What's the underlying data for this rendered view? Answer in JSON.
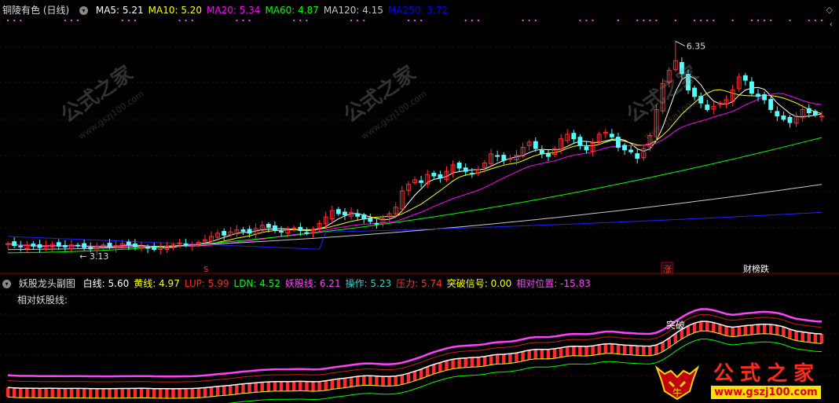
{
  "main_panel": {
    "stock_name": "铜陵有色 (日线)",
    "ma_labels": [
      {
        "text": "MA5: 5.21",
        "color": "#ffffff"
      },
      {
        "text": "MA10: 5.20",
        "color": "#ffff00"
      },
      {
        "text": "MA20: 5.34",
        "color": "#ff00ff"
      },
      {
        "text": "MA60: 4.87",
        "color": "#00ff00"
      },
      {
        "text": "MA120: 4.15",
        "color": "#c8c8c8"
      },
      {
        "text": "MA250: 3.72",
        "color": "#0000ff"
      }
    ],
    "high_annotation": "6.35",
    "low_annotation": "← 3.13",
    "event_labels": {
      "zhang": "涨",
      "caibang": "财榜跌",
      "marker": "S"
    }
  },
  "sub_panel": {
    "indicator_name": "妖股龙头副图",
    "sub_label": "相对妖股线:",
    "values": [
      {
        "text": "白线: 5.60",
        "color": "#ffffff"
      },
      {
        "text": "黄线: 4.97",
        "color": "#ffff00"
      },
      {
        "text": "LUP: 5.99",
        "color": "#ff2020"
      },
      {
        "text": "LDN: 4.52",
        "color": "#00ff00"
      },
      {
        "text": "妖股线: 6.21",
        "color": "#ff40ff"
      },
      {
        "text": "操作: 5.23",
        "color": "#40d0d0"
      },
      {
        "text": "压力: 5.74",
        "color": "#ff3030"
      },
      {
        "text": "突破信号: 0.00",
        "color": "#ffff00"
      },
      {
        "text": "相对位置: -15.83",
        "color": "#ff40ff"
      }
    ],
    "breakout_label": "突破"
  },
  "watermark": {
    "cn": "公式之家",
    "url": "www.gszj100.com"
  },
  "colors": {
    "up_candle": "#ff3030",
    "down_candle": "#54ffff",
    "background": "#000000"
  },
  "chart_data": {
    "type": "candlestick",
    "price_range": [
      3.0,
      6.5
    ],
    "close": [
      3.24,
      3.21,
      3.19,
      3.22,
      3.2,
      3.18,
      3.21,
      3.23,
      3.2,
      3.19,
      3.22,
      3.21,
      3.18,
      3.16,
      3.19,
      3.22,
      3.2,
      3.21,
      3.24,
      3.22,
      3.2,
      3.19,
      3.17,
      3.15,
      3.18,
      3.2,
      3.22,
      3.25,
      3.23,
      3.21,
      3.26,
      3.3,
      3.35,
      3.4,
      3.37,
      3.42,
      3.45,
      3.43,
      3.4,
      3.47,
      3.52,
      3.49,
      3.45,
      3.42,
      3.45,
      3.48,
      3.44,
      3.41,
      3.45,
      3.55,
      3.65,
      3.75,
      3.7,
      3.68,
      3.72,
      3.66,
      3.62,
      3.58,
      3.55,
      3.62,
      3.7,
      3.8,
      4.05,
      4.15,
      4.22,
      4.18,
      4.3,
      4.28,
      4.25,
      4.35,
      4.45,
      4.4,
      4.35,
      4.32,
      4.38,
      4.48,
      4.62,
      4.58,
      4.52,
      4.55,
      4.6,
      4.72,
      4.8,
      4.7,
      4.62,
      4.58,
      4.7,
      4.85,
      4.92,
      4.85,
      4.75,
      4.68,
      4.78,
      4.92,
      4.95,
      4.88,
      4.72,
      4.68,
      4.65,
      4.55,
      4.7,
      4.9,
      5.3,
      5.7,
      5.9,
      6.05,
      5.85,
      5.6,
      5.5,
      5.4,
      5.3,
      5.35,
      5.4,
      5.45,
      5.6,
      5.8,
      5.75,
      5.55,
      5.5,
      5.45,
      5.3,
      5.2,
      5.15,
      5.1,
      5.2,
      5.3,
      5.25,
      5.22,
      5.2
    ],
    "ma60_end": 4.87,
    "ma120_end": 4.15,
    "ma250_end": 3.72,
    "high_marker": 6.35,
    "low_marker": 3.13
  }
}
